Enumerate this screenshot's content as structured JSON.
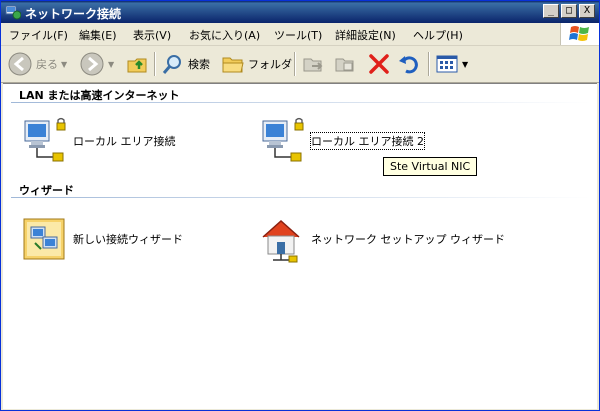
{
  "window": {
    "title": "ネットワーク接続"
  },
  "titlebar_buttons": {
    "minimize": "_",
    "maximize": "□",
    "close": "X"
  },
  "menu": [
    "ファイル(F)",
    "編集(E)",
    "表示(V)",
    "お気に入り(A)",
    "ツール(T)",
    "詳細設定(N)",
    "ヘルプ(H)"
  ],
  "toolbar": {
    "back_label": "戻る",
    "search_label": "検索",
    "folders_label": "フォルダ"
  },
  "groups": {
    "lan": {
      "header": "LAN または高速インターネット",
      "items": [
        {
          "label": "ローカル エリア接続"
        },
        {
          "label": "ローカル エリア接続 2"
        }
      ]
    },
    "wizard": {
      "header": "ウィザード",
      "items": [
        {
          "label": "新しい接続ウィザード"
        },
        {
          "label": "ネットワーク セットアップ ウィザード"
        }
      ]
    }
  },
  "tooltip": "Ste Virtual NIC",
  "colors": {
    "title_bar": "#0a246a",
    "content_bg": "#ffffff",
    "chrome_bg": "#ece9d8",
    "delete_red": "#e0201a"
  }
}
